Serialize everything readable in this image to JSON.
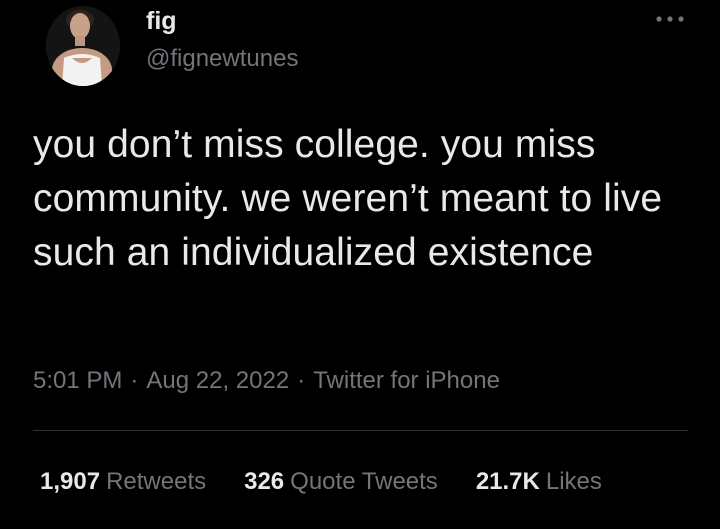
{
  "author": {
    "display_name": "fig",
    "handle": "@fignewtunes"
  },
  "tweet": {
    "text": "you don’t miss college. you miss community. we weren’t meant to live such an individualized existence"
  },
  "meta": {
    "time": "5:01 PM",
    "separator": "·",
    "date": "Aug 22, 2022",
    "source": "Twitter for iPhone"
  },
  "stats": {
    "retweets_count": "1,907",
    "retweets_label": "Retweets",
    "quotes_count": "326",
    "quotes_label": "Quote Tweets",
    "likes_count": "21.7K",
    "likes_label": "Likes"
  },
  "icons": {
    "more": "more-horizontal-icon"
  },
  "colors": {
    "background": "#000000",
    "primary_text": "#e7e9ea",
    "secondary_text": "#71767b",
    "divider": "#2f3336"
  }
}
